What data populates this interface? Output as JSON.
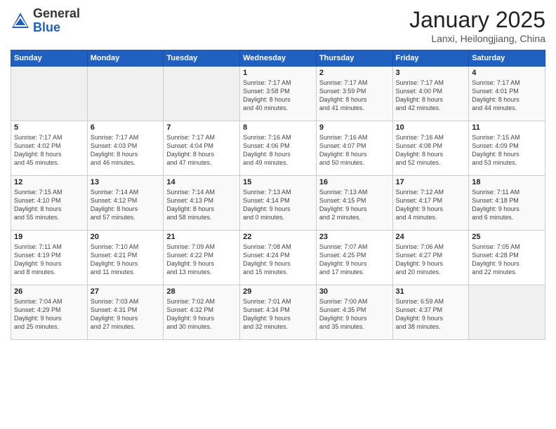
{
  "header": {
    "logo_general": "General",
    "logo_blue": "Blue",
    "month": "January 2025",
    "location": "Lanxi, Heilongjiang, China"
  },
  "weekdays": [
    "Sunday",
    "Monday",
    "Tuesday",
    "Wednesday",
    "Thursday",
    "Friday",
    "Saturday"
  ],
  "weeks": [
    [
      {
        "day": "",
        "info": ""
      },
      {
        "day": "",
        "info": ""
      },
      {
        "day": "",
        "info": ""
      },
      {
        "day": "1",
        "info": "Sunrise: 7:17 AM\nSunset: 3:58 PM\nDaylight: 8 hours\nand 40 minutes."
      },
      {
        "day": "2",
        "info": "Sunrise: 7:17 AM\nSunset: 3:59 PM\nDaylight: 8 hours\nand 41 minutes."
      },
      {
        "day": "3",
        "info": "Sunrise: 7:17 AM\nSunset: 4:00 PM\nDaylight: 8 hours\nand 42 minutes."
      },
      {
        "day": "4",
        "info": "Sunrise: 7:17 AM\nSunset: 4:01 PM\nDaylight: 8 hours\nand 44 minutes."
      }
    ],
    [
      {
        "day": "5",
        "info": "Sunrise: 7:17 AM\nSunset: 4:02 PM\nDaylight: 8 hours\nand 45 minutes."
      },
      {
        "day": "6",
        "info": "Sunrise: 7:17 AM\nSunset: 4:03 PM\nDaylight: 8 hours\nand 46 minutes."
      },
      {
        "day": "7",
        "info": "Sunrise: 7:17 AM\nSunset: 4:04 PM\nDaylight: 8 hours\nand 47 minutes."
      },
      {
        "day": "8",
        "info": "Sunrise: 7:16 AM\nSunset: 4:06 PM\nDaylight: 8 hours\nand 49 minutes."
      },
      {
        "day": "9",
        "info": "Sunrise: 7:16 AM\nSunset: 4:07 PM\nDaylight: 8 hours\nand 50 minutes."
      },
      {
        "day": "10",
        "info": "Sunrise: 7:16 AM\nSunset: 4:08 PM\nDaylight: 8 hours\nand 52 minutes."
      },
      {
        "day": "11",
        "info": "Sunrise: 7:15 AM\nSunset: 4:09 PM\nDaylight: 8 hours\nand 53 minutes."
      }
    ],
    [
      {
        "day": "12",
        "info": "Sunrise: 7:15 AM\nSunset: 4:10 PM\nDaylight: 8 hours\nand 55 minutes."
      },
      {
        "day": "13",
        "info": "Sunrise: 7:14 AM\nSunset: 4:12 PM\nDaylight: 8 hours\nand 57 minutes."
      },
      {
        "day": "14",
        "info": "Sunrise: 7:14 AM\nSunset: 4:13 PM\nDaylight: 8 hours\nand 58 minutes."
      },
      {
        "day": "15",
        "info": "Sunrise: 7:13 AM\nSunset: 4:14 PM\nDaylight: 9 hours\nand 0 minutes."
      },
      {
        "day": "16",
        "info": "Sunrise: 7:13 AM\nSunset: 4:15 PM\nDaylight: 9 hours\nand 2 minutes."
      },
      {
        "day": "17",
        "info": "Sunrise: 7:12 AM\nSunset: 4:17 PM\nDaylight: 9 hours\nand 4 minutes."
      },
      {
        "day": "18",
        "info": "Sunrise: 7:11 AM\nSunset: 4:18 PM\nDaylight: 9 hours\nand 6 minutes."
      }
    ],
    [
      {
        "day": "19",
        "info": "Sunrise: 7:11 AM\nSunset: 4:19 PM\nDaylight: 9 hours\nand 8 minutes."
      },
      {
        "day": "20",
        "info": "Sunrise: 7:10 AM\nSunset: 4:21 PM\nDaylight: 9 hours\nand 11 minutes."
      },
      {
        "day": "21",
        "info": "Sunrise: 7:09 AM\nSunset: 4:22 PM\nDaylight: 9 hours\nand 13 minutes."
      },
      {
        "day": "22",
        "info": "Sunrise: 7:08 AM\nSunset: 4:24 PM\nDaylight: 9 hours\nand 15 minutes."
      },
      {
        "day": "23",
        "info": "Sunrise: 7:07 AM\nSunset: 4:25 PM\nDaylight: 9 hours\nand 17 minutes."
      },
      {
        "day": "24",
        "info": "Sunrise: 7:06 AM\nSunset: 4:27 PM\nDaylight: 9 hours\nand 20 minutes."
      },
      {
        "day": "25",
        "info": "Sunrise: 7:05 AM\nSunset: 4:28 PM\nDaylight: 9 hours\nand 22 minutes."
      }
    ],
    [
      {
        "day": "26",
        "info": "Sunrise: 7:04 AM\nSunset: 4:29 PM\nDaylight: 9 hours\nand 25 minutes."
      },
      {
        "day": "27",
        "info": "Sunrise: 7:03 AM\nSunset: 4:31 PM\nDaylight: 9 hours\nand 27 minutes."
      },
      {
        "day": "28",
        "info": "Sunrise: 7:02 AM\nSunset: 4:32 PM\nDaylight: 9 hours\nand 30 minutes."
      },
      {
        "day": "29",
        "info": "Sunrise: 7:01 AM\nSunset: 4:34 PM\nDaylight: 9 hours\nand 32 minutes."
      },
      {
        "day": "30",
        "info": "Sunrise: 7:00 AM\nSunset: 4:35 PM\nDaylight: 9 hours\nand 35 minutes."
      },
      {
        "day": "31",
        "info": "Sunrise: 6:59 AM\nSunset: 4:37 PM\nDaylight: 9 hours\nand 38 minutes."
      },
      {
        "day": "",
        "info": ""
      }
    ]
  ]
}
